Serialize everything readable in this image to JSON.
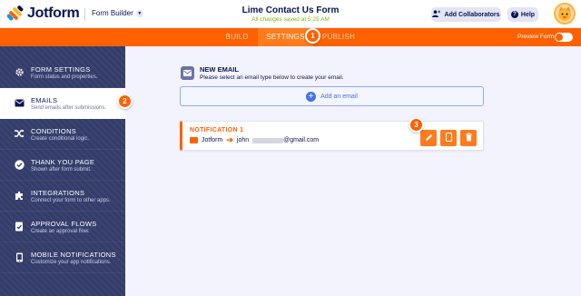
{
  "header": {
    "logo_text": "Jotform",
    "builder_label": "Form Builder",
    "form_title": "Lime Contact Us Form",
    "saved_status": "All changes saved at 5:25 AM",
    "collaborators_label": "Add Collaborators",
    "help_label": "Help"
  },
  "nav": {
    "tabs": [
      {
        "label": "BUILD"
      },
      {
        "label": "SETTINGS"
      },
      {
        "label": "PUBLISH"
      }
    ],
    "active_tab": "SETTINGS",
    "preview_label": "Preview Form"
  },
  "badges": [
    "1",
    "2",
    "3"
  ],
  "sidebar": {
    "items": [
      {
        "title": "FORM SETTINGS",
        "desc": "Form status and properties.",
        "icon": "gear-icon"
      },
      {
        "title": "EMAILS",
        "desc": "Send emails after submissions.",
        "icon": "envelope-icon"
      },
      {
        "title": "CONDITIONS",
        "desc": "Create conditional logic.",
        "icon": "shuffle-icon"
      },
      {
        "title": "THANK YOU PAGE",
        "desc": "Shown after form submit.",
        "icon": "check-circle-icon"
      },
      {
        "title": "INTEGRATIONS",
        "desc": "Connect your form to other apps.",
        "icon": "puzzle-icon"
      },
      {
        "title": "APPROVAL FLOWS",
        "desc": "Create an approval flow.",
        "icon": "approval-icon"
      },
      {
        "title": "MOBILE NOTIFICATIONS",
        "desc": "Customize your app notifications.",
        "icon": "mobile-icon"
      }
    ],
    "active_item": "EMAILS"
  },
  "main": {
    "new_email_title": "NEW EMAIL",
    "new_email_desc": "Please select an email type below to create your email.",
    "add_email_label": "Add an email",
    "notification": {
      "title": "NOTIFICATION 1",
      "from": "Jotform",
      "to_prefix": "john",
      "to_suffix": "@gmail.com"
    }
  },
  "colors": {
    "brand_orange": "#ff6100",
    "sidebar_navy": "#343c6a",
    "text_navy": "#0a1551",
    "accent_blue": "#4573e3",
    "saved_green": "#78bb07"
  }
}
